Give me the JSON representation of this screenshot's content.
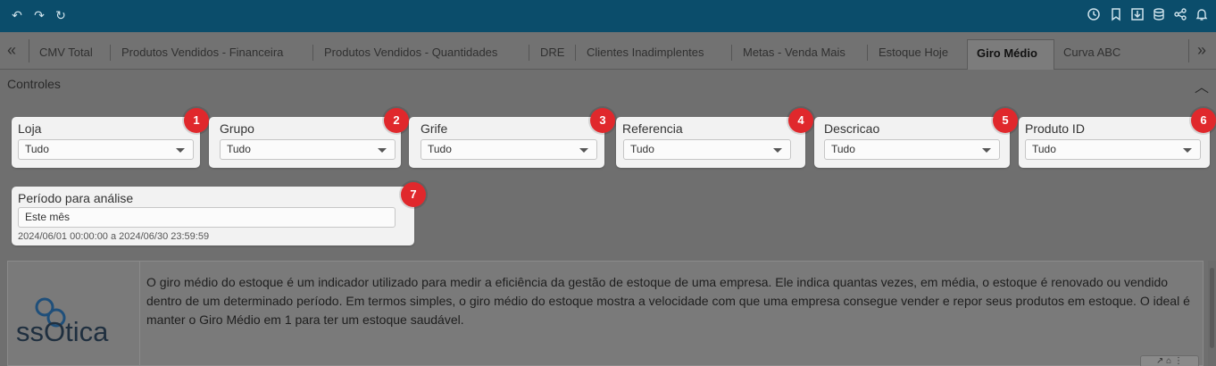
{
  "toolbar": {
    "left_icons": [
      "undo-icon",
      "redo-icon",
      "refresh-icon"
    ],
    "right_icons": [
      "history-icon",
      "bookmark-icon",
      "download-icon",
      "database-icon",
      "share-icon",
      "bell-icon"
    ]
  },
  "tabs": [
    {
      "label": "CMV Total"
    },
    {
      "label": "Produtos Vendidos - Financeira"
    },
    {
      "label": "Produtos Vendidos - Quantidades"
    },
    {
      "label": "DRE"
    },
    {
      "label": "Clientes Inadimplentes"
    },
    {
      "label": "Metas - Venda Mais"
    },
    {
      "label": "Estoque Hoje"
    },
    {
      "label": "Giro Médio",
      "active": true
    },
    {
      "label": "Curva ABC"
    }
  ],
  "tab_arrows": {
    "left": "«",
    "right": "»"
  },
  "controls": {
    "title": "Controles",
    "collapse_glyph": "︿",
    "filters": [
      {
        "number": "1",
        "label": "Loja",
        "value": "Tudo"
      },
      {
        "number": "2",
        "label": "Grupo",
        "value": "Tudo"
      },
      {
        "number": "3",
        "label": "Grife",
        "value": "Tudo"
      },
      {
        "number": "4",
        "label": "Referencia",
        "value": "Tudo"
      },
      {
        "number": "5",
        "label": "Descricao",
        "value": "Tudo"
      },
      {
        "number": "6",
        "label": "Produto ID",
        "value": "Tudo"
      }
    ],
    "period": {
      "number": "7",
      "label": "Período para análise",
      "value": "Este mês",
      "range": "2024/06/01 00:00:00 a 2024/06/30 23:59:59"
    }
  },
  "info_panel": {
    "logo_text": "ssOtica",
    "description": "O giro médio do estoque é um indicador utilizado para medir a eficiência da gestão de estoque de uma empresa. Ele indica quantas vezes, em média, o estoque é renovado ou vendido dentro de um determinado período. Em termos simples, o giro médio do estoque mostra a velocidade com que uma empresa consegue vender e repor seus produtos em estoque. O ideal é manter o Giro Médio em 1 para ter um estoque saudável."
  },
  "colors": {
    "topbar": "#0b4d6b",
    "badge": "#e0282c",
    "logo_blue": "#1f4f7a"
  }
}
